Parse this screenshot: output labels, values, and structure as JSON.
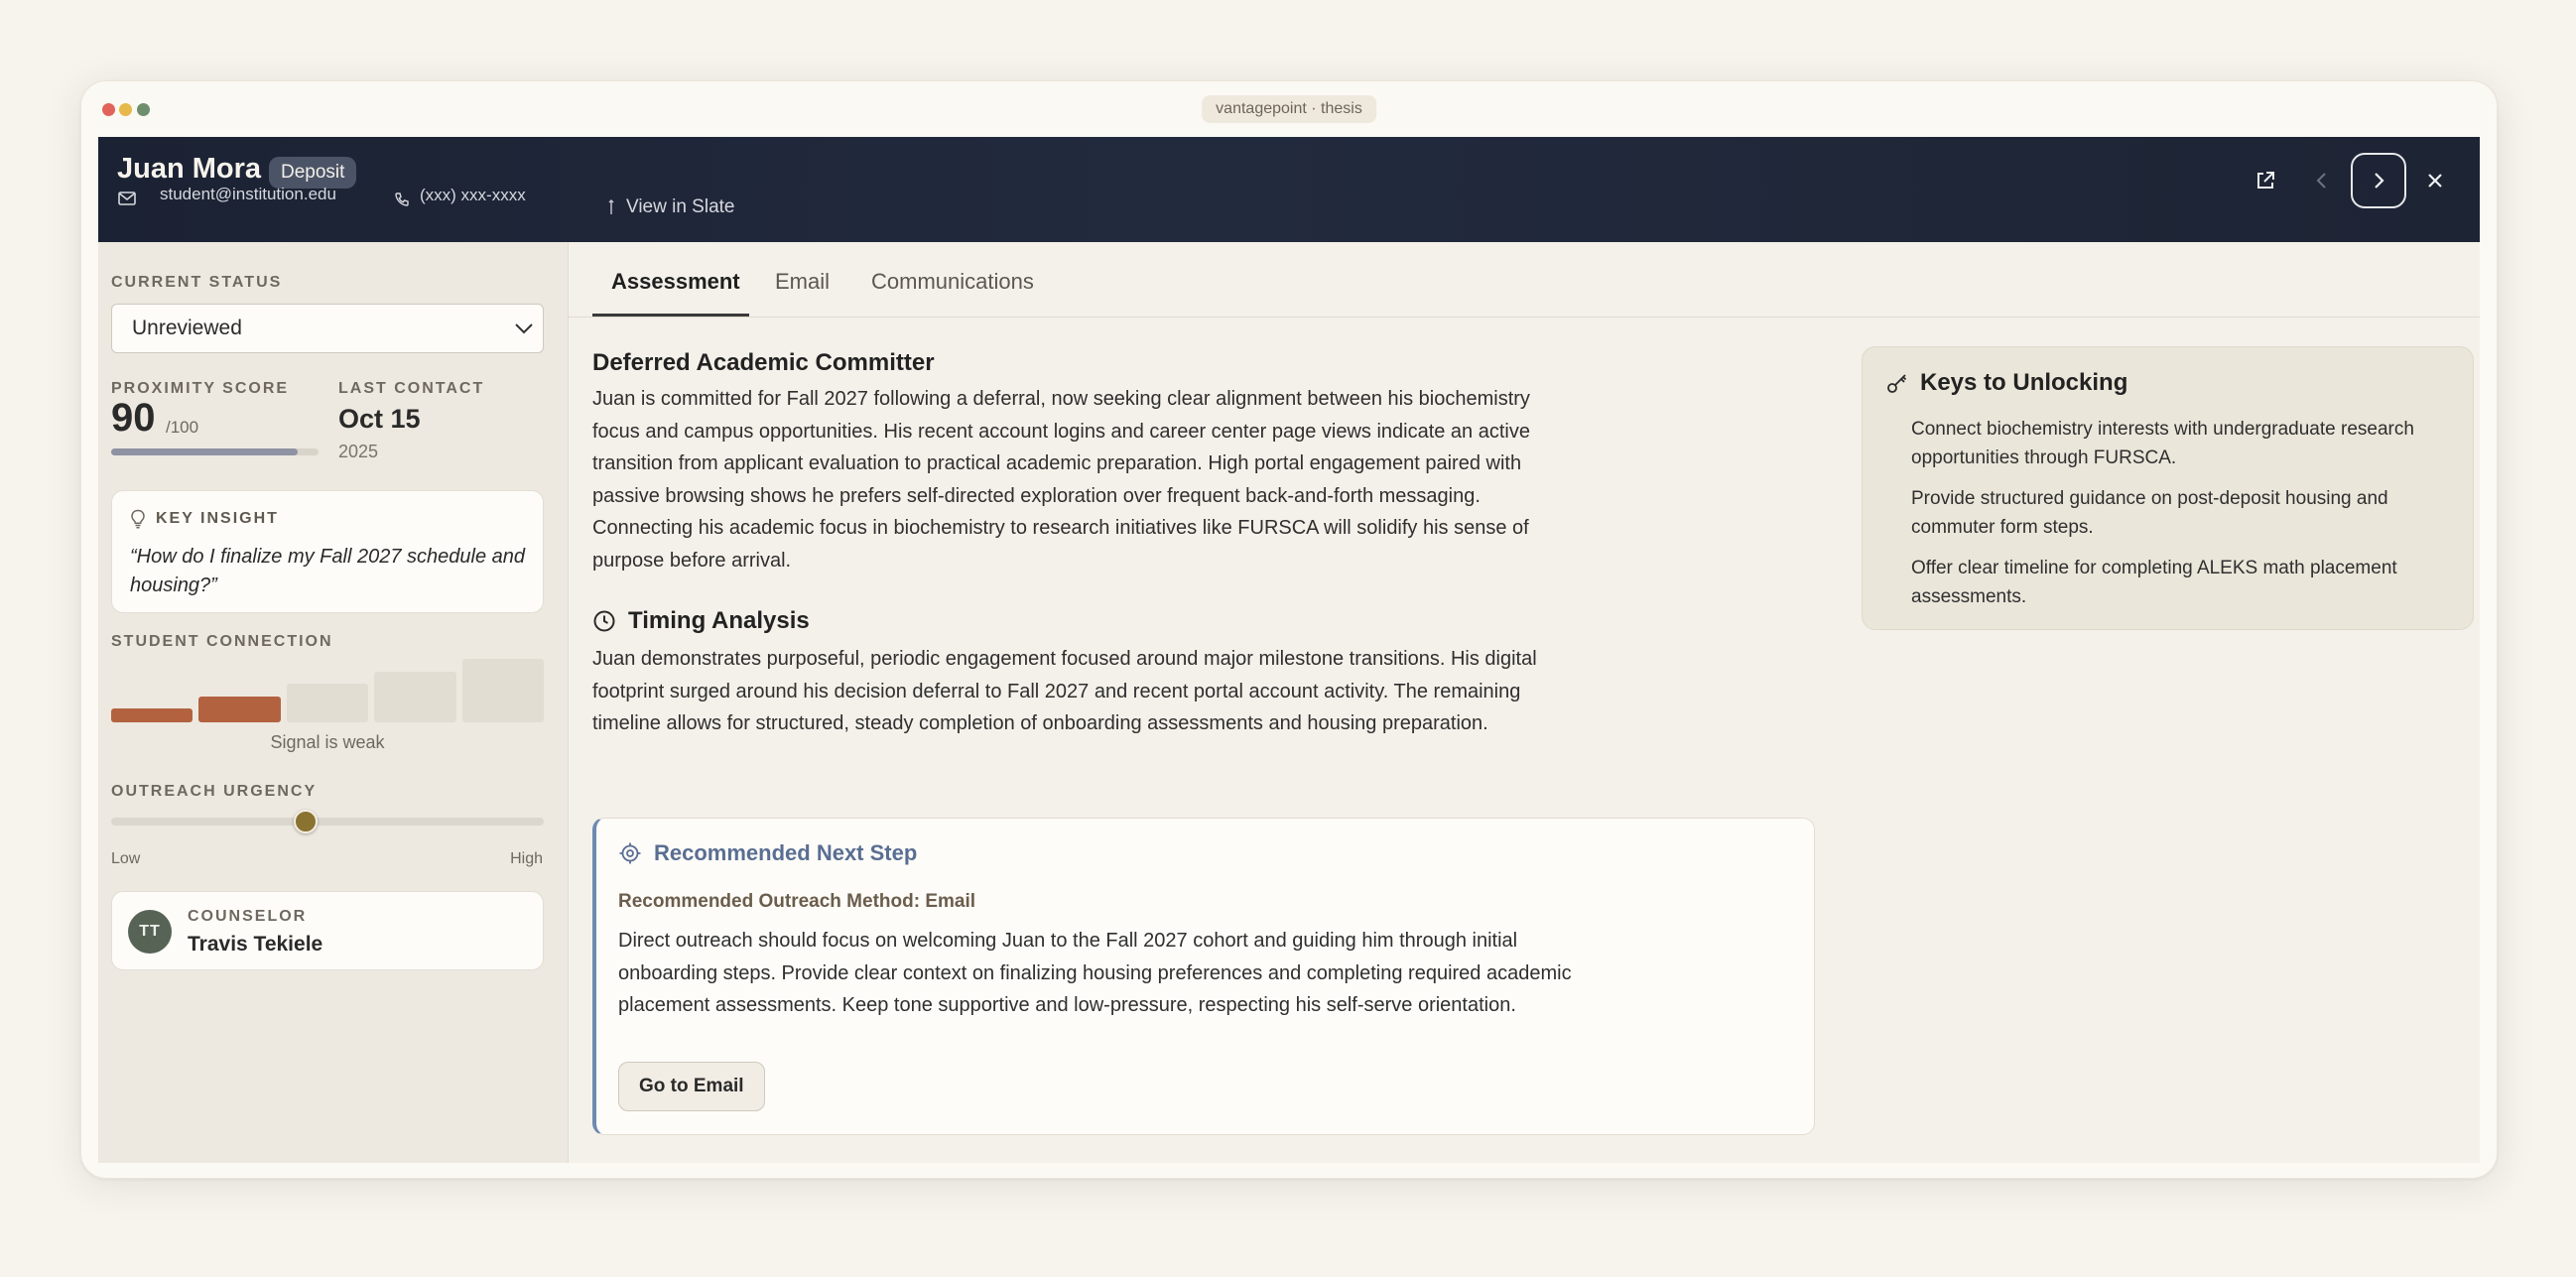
{
  "window": {
    "title": "vantagepoint · thesis"
  },
  "header": {
    "name": "Juan Mora",
    "badge": "Deposit",
    "email": "student@institution.edu",
    "phone": "(xxx) xxx-xxxx",
    "slate_link": "View in Slate",
    "icons": [
      "export-icon",
      "chevron-left-icon",
      "chevron-right-icon",
      "close-icon"
    ]
  },
  "sidebar": {
    "current_status_label": "CURRENT STATUS",
    "current_status_value": "Unreviewed",
    "proximity_label": "PROXIMITY SCORE",
    "proximity_score": "90",
    "proximity_max": "/100",
    "proximity_fraction": 0.9,
    "last_contact_label": "LAST CONTACT",
    "last_contact_date": "Oct 15",
    "last_contact_year": "2025",
    "key_insight_label": "KEY INSIGHT",
    "key_insight_quote": "“How do I finalize my Fall 2027 schedule and housing?”",
    "connection_label": "STUDENT CONNECTION",
    "connection_level": 2,
    "connection_total": 5,
    "signal_text": "Signal is weak",
    "urgency_label": "OUTREACH URGENCY",
    "urgency_value": 0.45,
    "urgency_low": "Low",
    "urgency_high": "High",
    "counselor_initials": "TT",
    "counselor_label": "COUNSELOR",
    "counselor_name": "Travis Tekiele"
  },
  "tabs": [
    {
      "label": "Assessment",
      "active": true
    },
    {
      "label": "Email",
      "active": false
    },
    {
      "label": "Communications",
      "active": false
    }
  ],
  "assessment": {
    "profile_title": "Deferred Academic Committer",
    "profile_text": "Juan is committed for Fall 2027 following a deferral, now seeking clear alignment between his biochemistry focus and campus opportunities. His recent account logins and career center page views indicate an active transition from applicant evaluation to practical academic preparation. High portal engagement paired with passive browsing shows he prefers self-directed exploration over frequent back-and-forth messaging. Connecting his academic focus in biochemistry to research initiatives like FURSCA will solidify his sense of purpose before arrival.",
    "timing_title": "Timing Analysis",
    "timing_text": "Juan demonstrates purposeful, periodic engagement focused around major milestone transitions. His digital footprint surged around his decision deferral to Fall 2027 and recent portal account activity. The remaining timeline allows for structured, steady completion of onboarding assessments and housing preparation.",
    "rec_title": "Recommended Next Step",
    "rec_method": "Recommended Outreach Method: Email",
    "rec_text": "Direct outreach should focus on welcoming Juan to the Fall 2027 cohort and guiding him through initial onboarding steps. Provide clear context on finalizing housing preferences and completing required academic placement assessments. Keep tone supportive and low-pressure, respecting his self-serve orientation.",
    "rec_button": "Go to Email",
    "keys_title": "Keys to Unlocking",
    "keys": [
      "Connect biochemistry interests with undergraduate research opportunities through FURSCA.",
      "Provide structured guidance on post-deposit housing and commuter form steps.",
      "Offer clear timeline for completing ALEKS math placement assessments."
    ]
  },
  "colors": {
    "header_bg": "#1d2434",
    "connection_active": "#b3623f",
    "connection_inactive": "#e2ddd2",
    "urgency_thumb": "#8a7230",
    "rec_accent": "#6d8ab0",
    "avatar_bg": "#566355"
  }
}
